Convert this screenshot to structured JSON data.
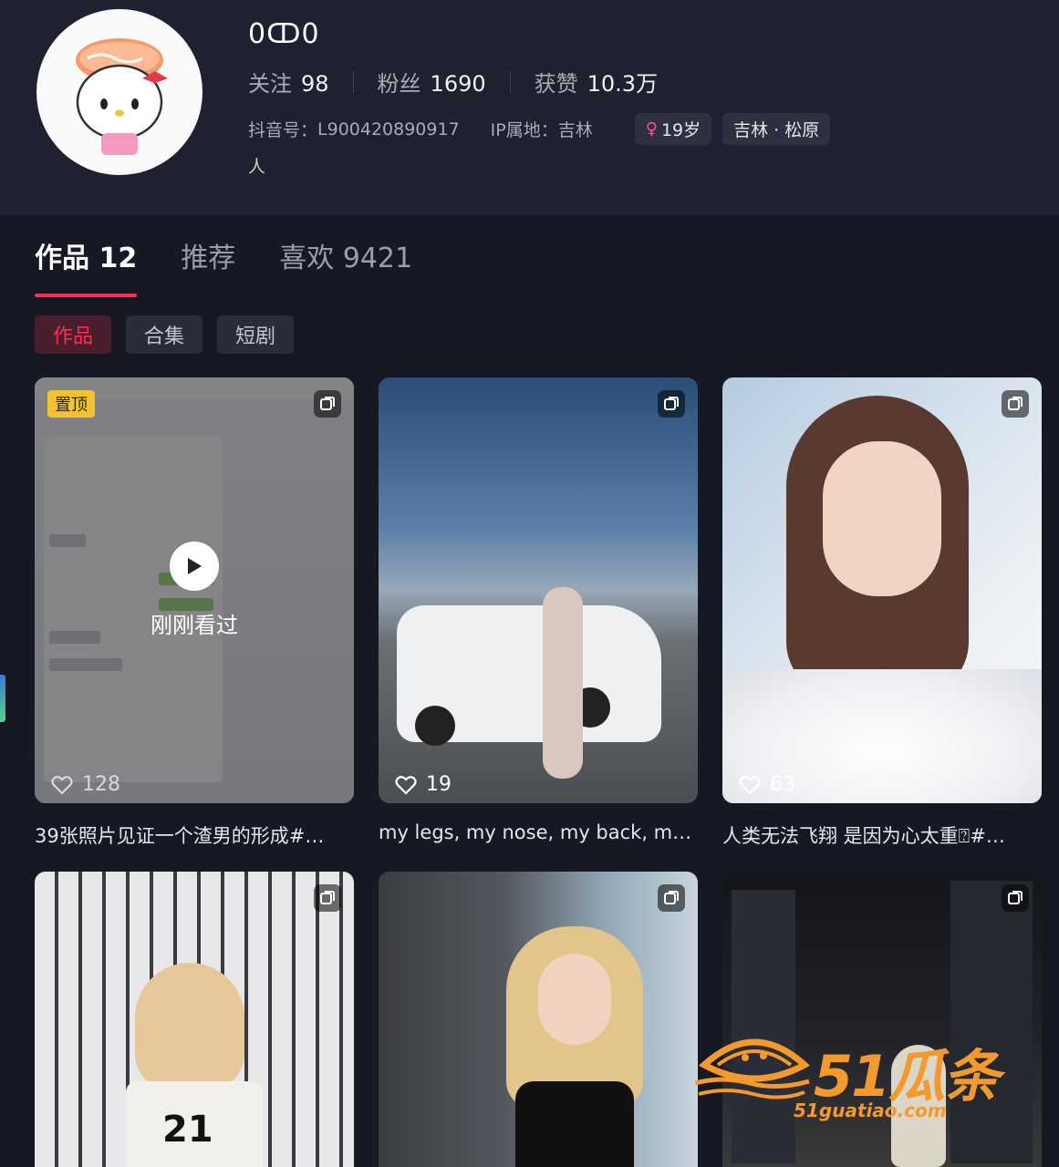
{
  "profile": {
    "username": "0ↀ0",
    "stats": [
      {
        "label": "关注",
        "value": "98"
      },
      {
        "label": "粉丝",
        "value": "1690"
      },
      {
        "label": "获赞",
        "value": "10.3万"
      }
    ],
    "douyin_id_label": "抖音号：",
    "douyin_id": "L900420890917",
    "ip_label": "IP属地：",
    "ip_location": "吉林",
    "age_tag": "19岁",
    "region_tag": "吉林 · 松原",
    "bio": "人"
  },
  "tabs": [
    {
      "label": "作品 12",
      "active": true
    },
    {
      "label": "推荐",
      "active": false
    },
    {
      "label": "喜欢 9421",
      "active": false
    }
  ],
  "subtabs": [
    {
      "label": "作品",
      "active": true
    },
    {
      "label": "合集",
      "active": false
    },
    {
      "label": "短剧",
      "active": false
    }
  ],
  "videos": [
    {
      "title": "39张照片见证一个渣男的形成#…",
      "likes": "128",
      "pinned_label": "置顶",
      "watched_label": "刚刚看过"
    },
    {
      "title": "my legs, my nose, my back, my…",
      "likes": "19"
    },
    {
      "title": "人类无法飞翔 是因为心太重⍰#…",
      "likes": "63"
    },
    {
      "title": "",
      "likes": ""
    },
    {
      "title": "",
      "likes": ""
    },
    {
      "title": "",
      "likes": ""
    }
  ],
  "watermark": {
    "main": "51瓜条",
    "url": "51guatiao.com"
  },
  "colors": {
    "accent": "#fe2c55",
    "background": "#161823",
    "card": "#1f2030"
  }
}
